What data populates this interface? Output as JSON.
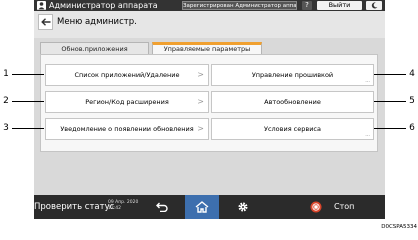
{
  "titlebar": {
    "app_title": "Администратор аппарата",
    "login_status": "Зарегистрирован Администратор аппарат",
    "help": "?",
    "logout": "Выйти",
    "user_icon": "person-icon",
    "energy_icon": "moon-icon"
  },
  "header": {
    "back_icon": "arrow-left-icon",
    "title": "Меню администр."
  },
  "tabs": [
    {
      "label": "Обнов.приложения",
      "active": false
    },
    {
      "label": "Управляемые параметры",
      "active": true
    }
  ],
  "buttons": {
    "app_list": "Список приложений/Удаление",
    "firmware": "Управление прошивкой",
    "region": "Регион/Код расширения",
    "auto_update": "Автообновление",
    "notify": "Уведомление о появлении обновления",
    "terms": "Условия сервиса",
    "chevron": ">",
    "more": "..."
  },
  "callouts": [
    "1",
    "2",
    "3",
    "4",
    "5",
    "6"
  ],
  "statusbar": {
    "check_status": "Проверить статус",
    "date": "09 Апр. 2020",
    "time": "12:42",
    "stop": "Стоп",
    "icons": [
      "return-icon",
      "home-icon",
      "gear-icon",
      "stop-icon"
    ]
  },
  "figure_id": "D0CSPA5334",
  "colors": {
    "titlebar": "#333333",
    "statusbar": "#2b2b2b",
    "home_active": "#3d6fae",
    "tab_accent": "#f0a030",
    "stop_red": "#d9452b"
  }
}
